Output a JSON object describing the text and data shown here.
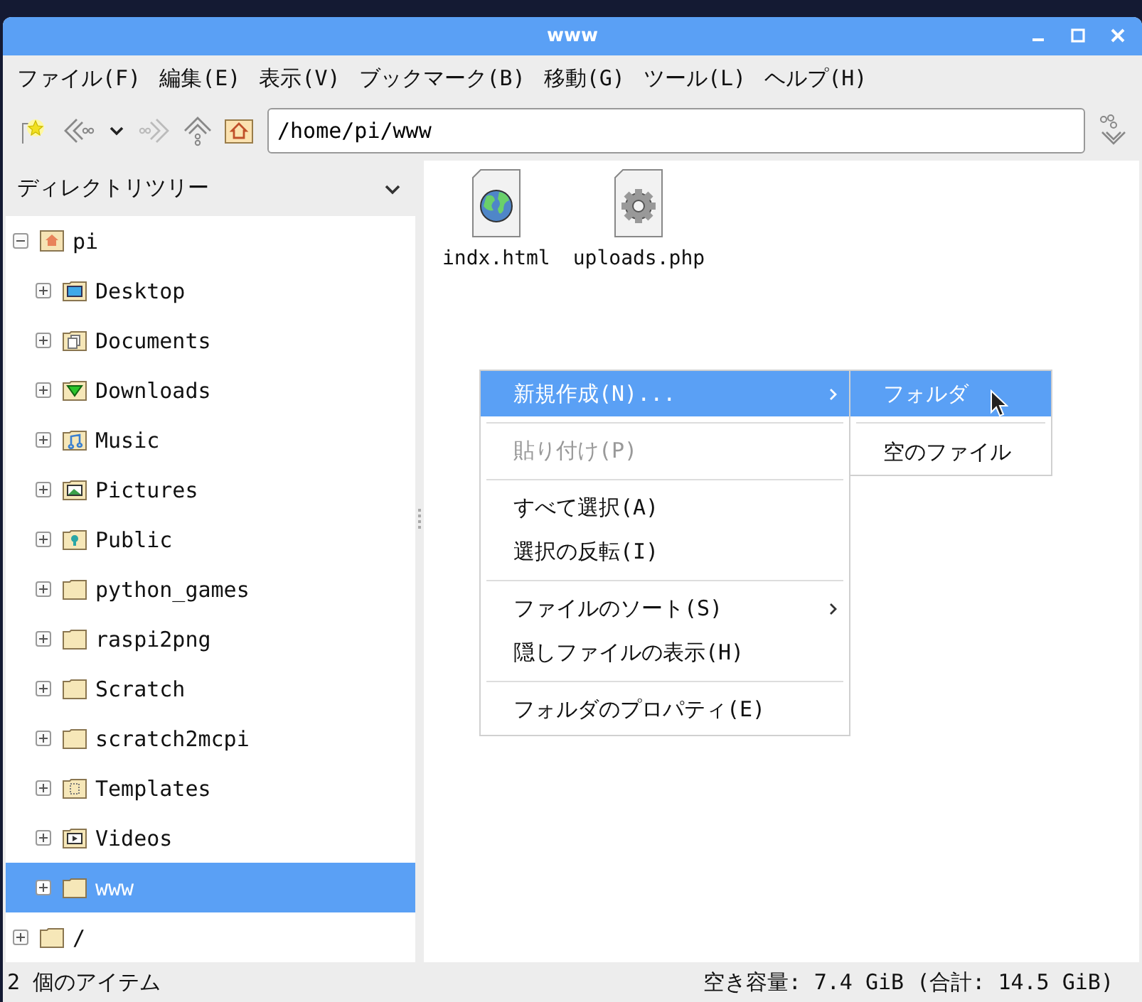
{
  "window": {
    "title": "www"
  },
  "menubar": [
    "ファイル(F)",
    "編集(E)",
    "表示(V)",
    "ブックマーク(B)",
    "移動(G)",
    "ツール(L)",
    "ヘルプ(H)"
  ],
  "toolbar": {
    "path": "/home/pi/www"
  },
  "sidebar": {
    "title": "ディレクトリツリー",
    "tree": [
      {
        "label": "pi",
        "kind": "home",
        "expanded": true,
        "selected": false,
        "children": [
          {
            "label": "Desktop",
            "kind": "desktop",
            "expanded": false,
            "selected": false
          },
          {
            "label": "Documents",
            "kind": "documents",
            "expanded": false,
            "selected": false
          },
          {
            "label": "Downloads",
            "kind": "downloads",
            "expanded": false,
            "selected": false
          },
          {
            "label": "Music",
            "kind": "music",
            "expanded": false,
            "selected": false
          },
          {
            "label": "Pictures",
            "kind": "pictures",
            "expanded": false,
            "selected": false
          },
          {
            "label": "Public",
            "kind": "public",
            "expanded": false,
            "selected": false
          },
          {
            "label": "python_games",
            "kind": "folder",
            "expanded": false,
            "selected": false
          },
          {
            "label": "raspi2png",
            "kind": "folder",
            "expanded": false,
            "selected": false
          },
          {
            "label": "Scratch",
            "kind": "folder",
            "expanded": false,
            "selected": false
          },
          {
            "label": "scratch2mcpi",
            "kind": "folder",
            "expanded": false,
            "selected": false
          },
          {
            "label": "Templates",
            "kind": "templates",
            "expanded": false,
            "selected": false
          },
          {
            "label": "Videos",
            "kind": "videos",
            "expanded": false,
            "selected": false
          },
          {
            "label": "www",
            "kind": "folder",
            "expanded": false,
            "selected": true
          }
        ]
      },
      {
        "label": "/",
        "kind": "folder",
        "expanded": false,
        "selected": false
      }
    ]
  },
  "files": [
    {
      "name": "indx.html",
      "kind": "web"
    },
    {
      "name": "uploads.php",
      "kind": "script"
    }
  ],
  "context_menu": {
    "groups": [
      [
        {
          "label": "新規作成(N)...",
          "selected": true,
          "disabled": false,
          "submenu": true
        }
      ],
      [
        {
          "label": "貼り付け(P)",
          "selected": false,
          "disabled": true,
          "submenu": false
        }
      ],
      [
        {
          "label": "すべて選択(A)",
          "selected": false,
          "disabled": false,
          "submenu": false
        },
        {
          "label": "選択の反転(I)",
          "selected": false,
          "disabled": false,
          "submenu": false
        }
      ],
      [
        {
          "label": "ファイルのソート(S)",
          "selected": false,
          "disabled": false,
          "submenu": true
        },
        {
          "label": "隠しファイルの表示(H)",
          "selected": false,
          "disabled": false,
          "submenu": false
        }
      ],
      [
        {
          "label": "フォルダのプロパティ(E)",
          "selected": false,
          "disabled": false,
          "submenu": false
        }
      ]
    ]
  },
  "submenu": {
    "groups": [
      [
        {
          "label": "フォルダ",
          "selected": true
        }
      ],
      [
        {
          "label": "空のファイル",
          "selected": false
        }
      ]
    ]
  },
  "status_bar": {
    "left": "2 個のアイテム",
    "right": "空き容量: 7.4 GiB (合計: 14.5 GiB)"
  }
}
